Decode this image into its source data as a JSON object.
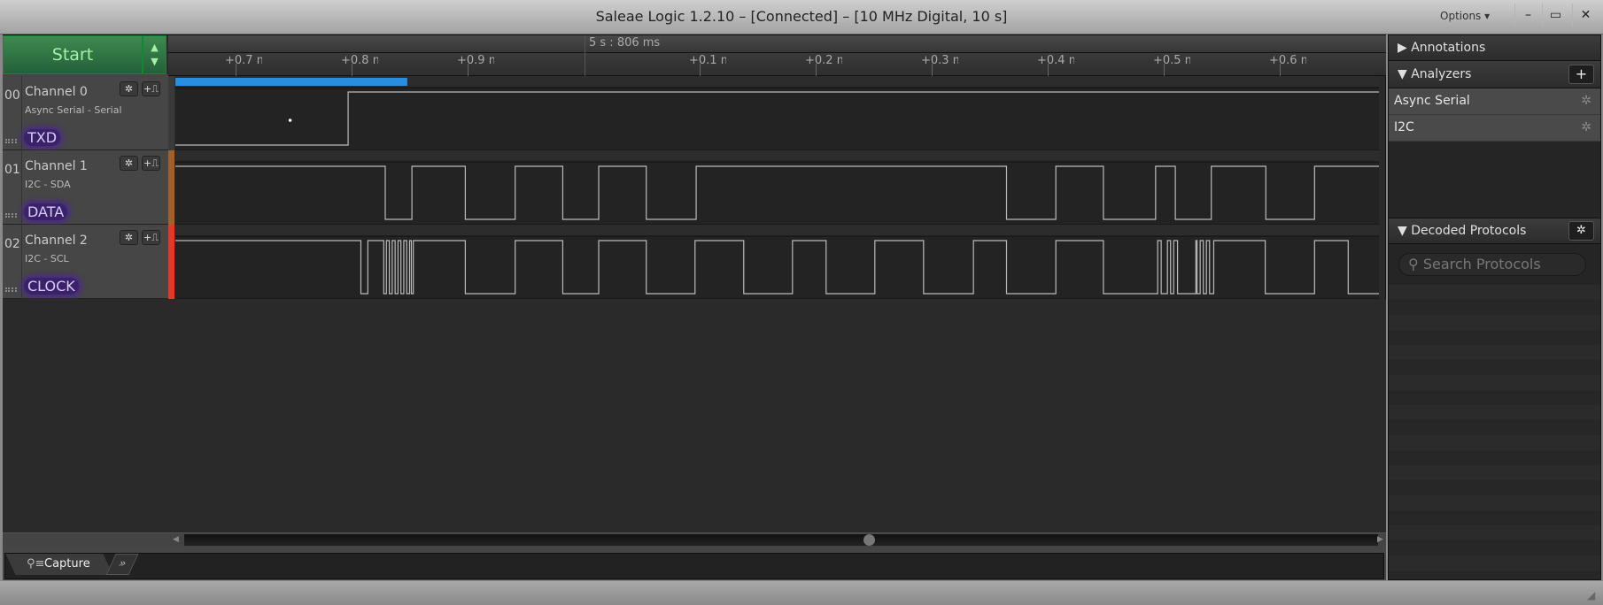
{
  "window": {
    "title": "Saleae Logic 1.2.10 – [Connected] – [10 MHz Digital, 10 s]",
    "options_label": "Options ▾",
    "minimize": "–",
    "maximize": "▭",
    "close": "✕"
  },
  "capture": {
    "start_label": "Start",
    "arrows": "▲▼"
  },
  "timeline": {
    "reference": "5 s : 806 ms",
    "ticks": [
      {
        "label": "+0.7 ms",
        "t": 0.7
      },
      {
        "label": "+0.8 ms",
        "t": 0.8
      },
      {
        "label": "+0.9 ms",
        "t": 0.9
      },
      {
        "label": "+0.1 ms",
        "t": 1.1
      },
      {
        "label": "+0.2 ms",
        "t": 1.2
      },
      {
        "label": "+0.3 ms",
        "t": 1.3
      },
      {
        "label": "+0.4 ms",
        "t": 1.4
      },
      {
        "label": "+0.5 ms",
        "t": 1.5
      },
      {
        "label": "+0.6 ms",
        "t": 1.6
      }
    ],
    "view_range_ms": [
      0.648,
      1.686
    ],
    "selection_ms": [
      0.648,
      0.848
    ],
    "selection_color": "#2a8ee0",
    "cursor_ms": 0.747
  },
  "channels": [
    {
      "num": "00",
      "name": "Channel 0",
      "subtitle": "Async Serial - Serial",
      "label": "TXD",
      "color": "#3a3a3a",
      "initial": 0,
      "edges": [
        0.797
      ]
    },
    {
      "num": "01",
      "name": "Channel 1",
      "subtitle": "I2C - SDA",
      "label": "DATA",
      "color": "#a0602a",
      "initial": 1,
      "edges": [
        0.829,
        0.852,
        0.898,
        0.941,
        0.982,
        1.013,
        1.054,
        1.097,
        1.3645,
        1.407,
        1.448,
        1.493,
        1.51,
        1.541,
        1.588,
        1.63
      ]
    },
    {
      "num": "02",
      "name": "Channel 2",
      "subtitle": "I2C - SCL",
      "label": "CLOCK",
      "color": "#e03a2a",
      "initial": 1,
      "edges": [
        0.808,
        0.814,
        0.8277,
        0.83,
        0.8325,
        0.835,
        0.8375,
        0.84,
        0.8425,
        0.845,
        0.8475,
        0.85,
        0.8515,
        0.8532,
        0.898,
        0.941,
        0.982,
        1.013,
        1.054,
        1.096,
        1.138,
        1.18,
        1.209,
        1.251,
        1.293,
        1.336,
        1.3645,
        1.407,
        1.448,
        1.4948,
        1.4978,
        1.5032,
        1.5059,
        1.5086,
        1.5119,
        1.5277,
        1.5287,
        1.5314,
        1.5341,
        1.5368,
        1.5395,
        1.5431,
        1.5875,
        1.63,
        1.659
      ]
    }
  ],
  "tabs": {
    "capture": "Capture",
    "more": "»"
  },
  "right_panel": {
    "annotations": "Annotations",
    "analyzers": "Analyzers",
    "add": "+",
    "analyzer_items": [
      {
        "label": "Async Serial"
      },
      {
        "label": "I2C"
      }
    ],
    "decoded": "Decoded Protocols",
    "search_placeholder": "Search Protocols"
  }
}
